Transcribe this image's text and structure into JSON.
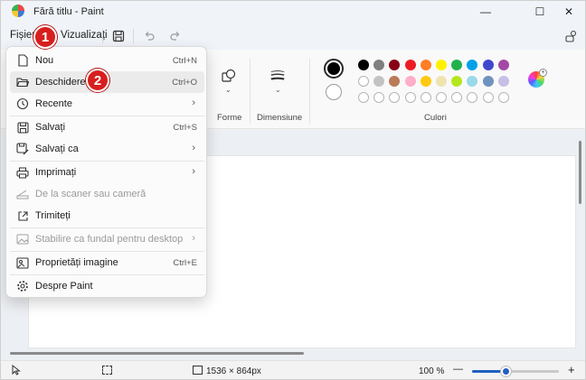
{
  "window": {
    "title": "Fără titlu - Paint",
    "minimize": "—",
    "maximize": "☐",
    "close": "✕"
  },
  "menubar": {
    "file": "Fișier",
    "view": "Vizualizați"
  },
  "badges": {
    "one": "1",
    "two": "2"
  },
  "ribbon": {
    "shapes_label": "Forme",
    "size_label": "Dimensiune",
    "colors_label": "Culori",
    "colors": {
      "row1": [
        "#000000",
        "#7f7f7f",
        "#880015",
        "#ed1c24",
        "#ff7f27",
        "#fff200",
        "#22b14c",
        "#00a2e8",
        "#3f48cc",
        "#a349a4"
      ],
      "row2": [
        "#ffffff",
        "#c3c3c3",
        "#b97a57",
        "#ffaec9",
        "#ffc90e",
        "#efe4b0",
        "#b5e61d",
        "#99d9ea",
        "#7092be",
        "#c8bfe7"
      ],
      "primary": "#000000",
      "secondary": "#ffffff"
    }
  },
  "menu": {
    "items": [
      {
        "label": "Nou",
        "shortcut": "Ctrl+N",
        "icon": "new-file-icon"
      },
      {
        "label": "Deschidere",
        "shortcut": "Ctrl+O",
        "icon": "folder-open-icon"
      },
      {
        "label": "Recente",
        "icon": "clock-icon"
      },
      {
        "label": "Salvați",
        "shortcut": "Ctrl+S",
        "icon": "save-icon"
      },
      {
        "label": "Salvați ca",
        "icon": "save-as-icon"
      },
      {
        "label": "Imprimați",
        "icon": "printer-icon"
      },
      {
        "label": "De la scaner sau cameră",
        "icon": "scanner-icon"
      },
      {
        "label": "Trimiteți",
        "icon": "share-icon"
      },
      {
        "label": "Stabilire ca fundal pentru desktop",
        "icon": "wallpaper-icon"
      },
      {
        "label": "Proprietăți imagine",
        "shortcut": "Ctrl+E",
        "icon": "image-properties-icon"
      },
      {
        "label": "Despre Paint",
        "icon": "gear-icon"
      }
    ]
  },
  "status": {
    "dimensions": "1536 × 864px",
    "zoom": "100 %",
    "zoom_out": "—",
    "zoom_in": "+"
  }
}
